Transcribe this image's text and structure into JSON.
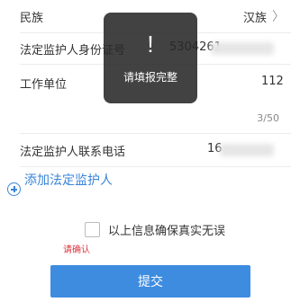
{
  "form": {
    "ethnicity": {
      "label": "民族",
      "value": "汉族",
      "chevron": "chevron-right-icon"
    },
    "guardian_id": {
      "label": "法定监护人身份证号",
      "value_visible": "5304261"
    },
    "work_unit": {
      "label": "工作单位",
      "value_visible": "112",
      "counter": "3/50"
    },
    "guardian_phone": {
      "label": "法定监护人联系电话",
      "value_visible": "16"
    }
  },
  "add_guardian": {
    "icon": "plus-circle-icon",
    "label": "添加法定监护人"
  },
  "confirm": {
    "label": "以上信息确保真实无误",
    "checked": false,
    "error": "请确认"
  },
  "submit": {
    "label": "提交"
  },
  "toast": {
    "icon_text": "!",
    "message": "请填报完整"
  },
  "colors": {
    "accent": "#3d8ce0",
    "link": "#3a84d8",
    "error": "#d9363e",
    "toast_bg": "#282828"
  }
}
